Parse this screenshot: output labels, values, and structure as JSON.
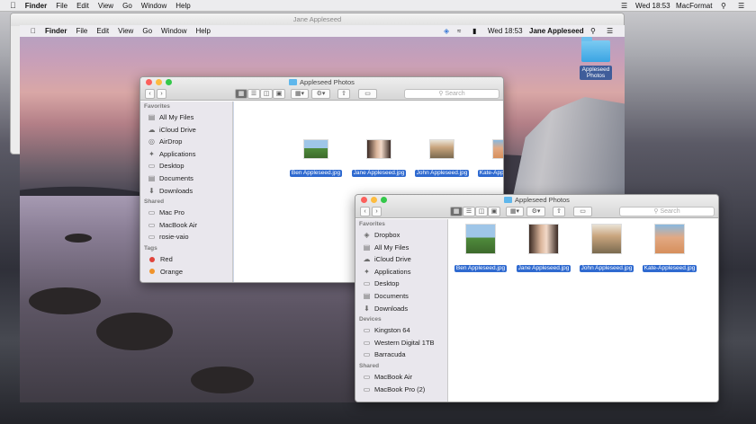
{
  "menubar": {
    "app": "Finder",
    "items": [
      "File",
      "Edit",
      "View",
      "Go",
      "Window",
      "Help"
    ],
    "clock": "Wed 18:53",
    "user": "MacFormat"
  },
  "remote_window": {
    "title": "Jane Appleseed"
  },
  "remote_menubar": {
    "app": "Finder",
    "items": [
      "File",
      "Edit",
      "View",
      "Go",
      "Window",
      "Help"
    ],
    "clock": "Wed 18:53",
    "user": "Jane Appleseed"
  },
  "desktop_folder": {
    "label": "Appleseed Photos"
  },
  "finder_back": {
    "title": "Appleseed Photos",
    "search_placeholder": "Search",
    "sidebar": [
      {
        "type": "header",
        "label": "Favorites"
      },
      {
        "type": "item",
        "label": "All My Files",
        "icon": "files-icon"
      },
      {
        "type": "item",
        "label": "iCloud Drive",
        "icon": "cloud-icon"
      },
      {
        "type": "item",
        "label": "AirDrop",
        "icon": "airdrop-icon"
      },
      {
        "type": "item",
        "label": "Applications",
        "icon": "applications-icon"
      },
      {
        "type": "item",
        "label": "Desktop",
        "icon": "desktop-icon"
      },
      {
        "type": "item",
        "label": "Documents",
        "icon": "documents-icon"
      },
      {
        "type": "item",
        "label": "Downloads",
        "icon": "downloads-icon"
      },
      {
        "type": "header",
        "label": "Shared"
      },
      {
        "type": "item",
        "label": "Mac Pro",
        "icon": "computer-icon"
      },
      {
        "type": "item",
        "label": "MacBook Air",
        "icon": "laptop-icon"
      },
      {
        "type": "item",
        "label": "rosie-vaio",
        "icon": "pc-icon"
      },
      {
        "type": "header",
        "label": "Tags"
      },
      {
        "type": "tag",
        "label": "Red",
        "color": "#e0443c"
      },
      {
        "type": "tag",
        "label": "Orange",
        "color": "#f0932b"
      }
    ],
    "files": [
      "Ben Appleseed.jpg",
      "Jane Appleseed.jpg",
      "John Appleseed.jpg",
      "Kate-Appleseed.jpg"
    ]
  },
  "finder_front": {
    "title": "Appleseed Photos",
    "search_placeholder": "Search",
    "sidebar": [
      {
        "type": "header",
        "label": "Favorites"
      },
      {
        "type": "item",
        "label": "Dropbox",
        "icon": "dropbox-icon"
      },
      {
        "type": "item",
        "label": "All My Files",
        "icon": "files-icon"
      },
      {
        "type": "item",
        "label": "iCloud Drive",
        "icon": "cloud-icon"
      },
      {
        "type": "item",
        "label": "Applications",
        "icon": "applications-icon"
      },
      {
        "type": "item",
        "label": "Desktop",
        "icon": "desktop-icon"
      },
      {
        "type": "item",
        "label": "Documents",
        "icon": "documents-icon"
      },
      {
        "type": "item",
        "label": "Downloads",
        "icon": "downloads-icon"
      },
      {
        "type": "header",
        "label": "Devices"
      },
      {
        "type": "item",
        "label": "Kingston 64",
        "icon": "drive-icon"
      },
      {
        "type": "item",
        "label": "Western Digital 1TB",
        "icon": "drive-icon"
      },
      {
        "type": "item",
        "label": "Barracuda",
        "icon": "drive-icon"
      },
      {
        "type": "header",
        "label": "Shared"
      },
      {
        "type": "item",
        "label": "MacBook Air",
        "icon": "laptop-icon"
      },
      {
        "type": "item",
        "label": "MacBook Pro (2)",
        "icon": "laptop-icon"
      }
    ],
    "files": [
      "Ben Appleseed.jpg",
      "Jane Appleseed.jpg",
      "John Appleseed.jpg",
      "Kate-Appleseed.jpg"
    ]
  },
  "colors": {
    "selection": "#2f6ad0",
    "close": "#fc605c",
    "minimize": "#fdbc40",
    "zoom": "#34c84a",
    "folder": "#5fb7ec"
  }
}
